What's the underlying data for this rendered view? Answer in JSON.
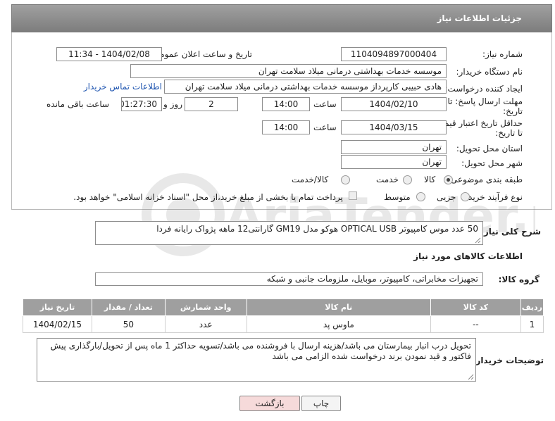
{
  "header": {
    "title": "جزئیات اطلاعات نیاز"
  },
  "fields": {
    "need_number_label": "شماره نیاز:",
    "need_number": "1104094897000404",
    "announce_label": "تاریخ و ساعت اعلان عمومی:",
    "announce_value": "1404/02/08 - 11:34",
    "buyer_org_label": "نام دستگاه خریدار:",
    "buyer_org": "موسسه خدمات بهداشتی درمانی میلاد سلامت تهران",
    "creator_label": "ایجاد کننده درخواست:",
    "creator": "هادی حبیبی کارپرداز موسسه خدمات بهداشتی درمانی میلاد سلامت تهران",
    "contact_link": "اطلاعات تماس خریدار",
    "deadline_label_1": "مهلت ارسال پاسخ: تا",
    "deadline_label_2": "تاریخ:",
    "deadline_date": "1404/02/10",
    "time_label": "ساعت",
    "deadline_time": "14:00",
    "days_value": "2",
    "days_label": "روز و",
    "remaining_time": "01:27:30",
    "remaining_label": "ساعت باقی مانده",
    "validity_label_1": "حداقل تاریخ اعتبار قیمت:",
    "validity_label_2": "تا تاریخ:",
    "validity_date": "1404/03/15",
    "validity_time_label": "ساعت",
    "validity_time": "14:00",
    "province_label": "استان محل تحویل:",
    "province": "تهران",
    "city_label": "شهر محل تحویل:",
    "city": "تهران",
    "category_label": "طبقه بندی موضوعی:",
    "category_options": [
      "کالا",
      "خدمت",
      "کالا/خدمت"
    ],
    "process_label": "نوع فرآیند خرید :",
    "process_options": [
      "جزیی",
      "متوسط"
    ],
    "payment_note": "پرداخت تمام یا بخشی از مبلغ خرید،از محل \"اسناد خزانه اسلامی\" خواهد بود."
  },
  "description": {
    "label": "شرح کلی نیاز:",
    "text": "50 عدد موس کامپیوتر OPTICAL USB هوکو مدل GM19 گارانتی12 ماهه پژواک رایانه فردا"
  },
  "goods_info": {
    "section_title": "اطلاعات کالاهای مورد نیاز",
    "group_label": "گروه کالا:",
    "group_value": "تجهیزات مخابراتی، کامپیوتر، موبایل، ملزومات جانبی و شبکه"
  },
  "table": {
    "headers": [
      "ردیف",
      "کد کالا",
      "نام کالا",
      "واحد شمارش",
      "تعداد / مقدار",
      "تاریخ نیاز"
    ],
    "rows": [
      [
        "1",
        "--",
        "ماوس پد",
        "عدد",
        "50",
        "1404/02/15"
      ]
    ]
  },
  "buyer_notes": {
    "label": "توضیحات خریدار:",
    "text": "تحویل درب انبار بیمارستان می باشد/هزینه ارسال با فروشنده می باشد/تسویه حداکثر 1 ماه پس از تحویل/بارگذاری پیش فاکتور و قید نمودن برند درخواست شده الزامی می باشد"
  },
  "buttons": {
    "print": "چاپ",
    "back": "بازگشت"
  },
  "colors": {
    "header_bg": "#8c8c8c",
    "link": "#1f55b0",
    "back_button_bg": "#f6dada"
  }
}
